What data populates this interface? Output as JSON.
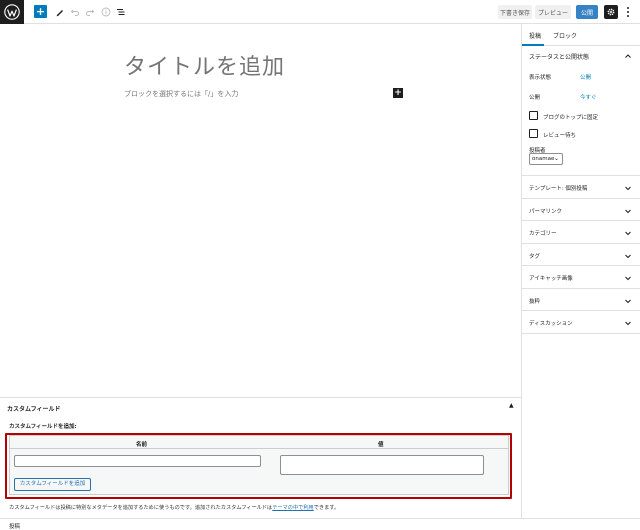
{
  "toolbar": {
    "save_draft": "下書き保存",
    "preview": "プレビュー",
    "publish": "公開"
  },
  "editor": {
    "title_placeholder": "タイトルを追加",
    "block_placeholder": "ブロックを選択するには「/」を入力"
  },
  "sidebar": {
    "tabs": [
      "投稿",
      "ブロック"
    ],
    "status_panel": {
      "title": "ステータスと公開状態",
      "visibility_label": "表示状態",
      "visibility_value": "公開",
      "publish_label": "公開",
      "publish_value": "今すぐ",
      "stick_to_top": "ブログのトップに固定",
      "pending_review": "レビュー待ち",
      "author_label": "投稿者",
      "author_value": "onamae"
    },
    "panels": [
      "テンプレート: 個別投稿",
      "パーマリンク",
      "カテゴリー",
      "タグ",
      "アイキャッチ画像",
      "抜粋",
      "ディスカッション"
    ]
  },
  "custom_fields": {
    "title": "カスタムフィールド",
    "add_new_label": "カスタムフィールドを追加:",
    "col_name": "名前",
    "col_value": "値",
    "add_button": "カスタムフィールドを追加",
    "note_before": "カスタムフィールドは投稿に特別なメタデータを追加するために使うものです。追加されたカスタムフィールドは",
    "note_link": "テーマの中で利用",
    "note_after": "できます。"
  },
  "footer": {
    "breadcrumb": "投稿"
  }
}
